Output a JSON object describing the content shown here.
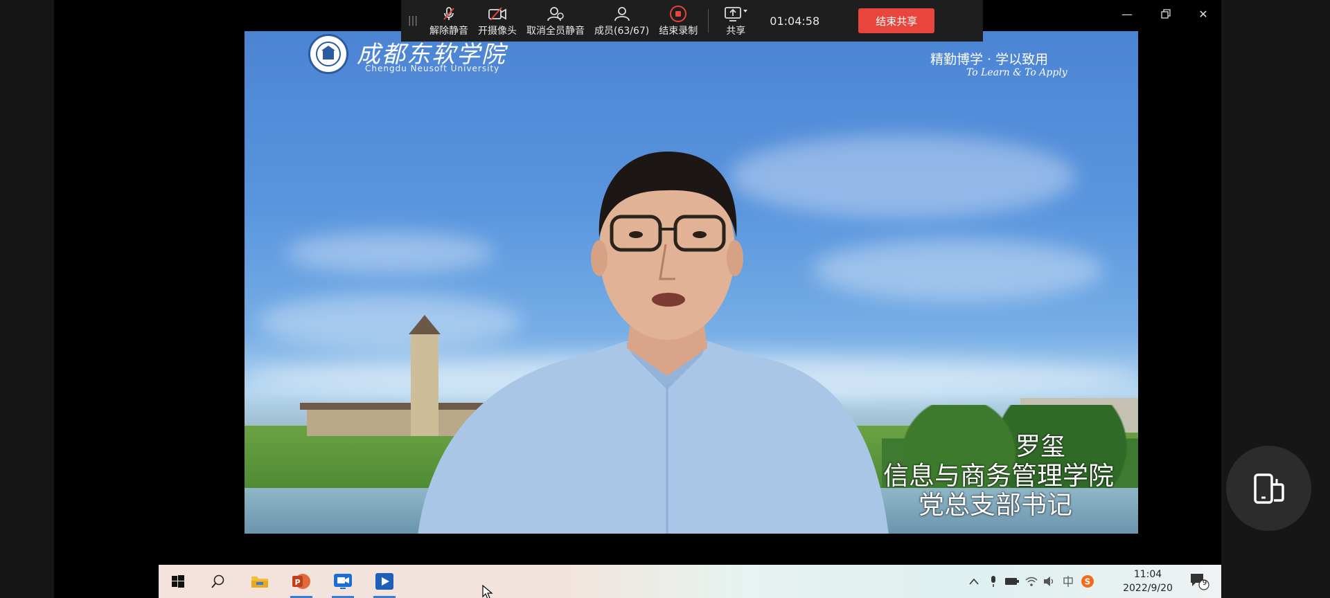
{
  "toolbar": {
    "unmute_label": "解除静音",
    "camera_label": "开摄像头",
    "unmute_all_label": "取消全员静音",
    "members_label": "成员(63/67)",
    "stop_record_label": "结束录制",
    "share_label": "共享",
    "timer": "01:04:58",
    "end_share_label": "结束共享"
  },
  "video": {
    "logo_cn": "成都东软学院",
    "logo_en": "Chengdu Neusoft University",
    "motto_cn": "精勤博学 · 学以致用",
    "motto_en": "To Learn & To Apply",
    "caption": {
      "name": "罗玺",
      "line2": "信息与商务管理学院",
      "line3": "党总支部书记"
    }
  },
  "taskbar": {
    "clock_time": "11:04",
    "clock_date": "2022/9/20",
    "notification_count": "9"
  },
  "colors": {
    "end_share": "#e8453c",
    "toolbar_bg": "#1e1e1e",
    "record": "#e8453c"
  },
  "icons": [
    "mic-off-icon",
    "camera-off-icon",
    "unmute-all-icon",
    "members-icon",
    "record-stop-icon",
    "share-screen-icon",
    "minimize-icon",
    "restore-icon",
    "close-icon",
    "windows-start-icon",
    "search-icon",
    "file-explorer-icon",
    "powerpoint-icon",
    "meeting-app-icon",
    "video-player-icon",
    "chevron-up-icon",
    "mic-tray-icon",
    "battery-icon",
    "wifi-icon",
    "volume-icon",
    "ime-icon",
    "sogou-icon",
    "notification-icon",
    "phone-switch-icon"
  ]
}
